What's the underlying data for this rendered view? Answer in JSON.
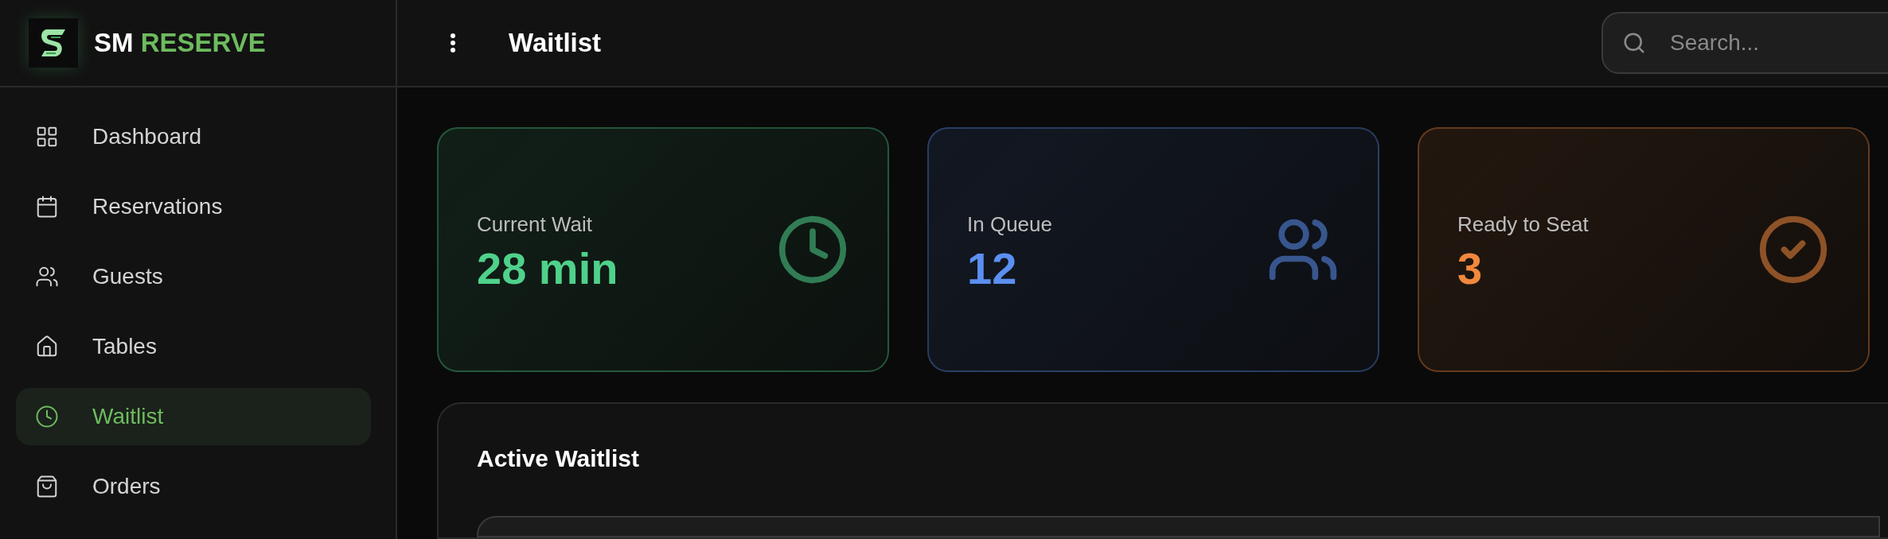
{
  "brand": {
    "name": "SM",
    "accent": "RESERVE"
  },
  "header": {
    "title": "Waitlist",
    "search": {
      "placeholder": "Search..."
    }
  },
  "sidebar": {
    "items": [
      {
        "label": "Dashboard",
        "kind": "grid",
        "selected": false
      },
      {
        "label": "Reservations",
        "kind": "calendar",
        "selected": false
      },
      {
        "label": "Guests",
        "kind": "users",
        "selected": false
      },
      {
        "label": "Tables",
        "kind": "home",
        "selected": false
      },
      {
        "label": "Waitlist",
        "kind": "clock",
        "selected": true
      },
      {
        "label": "Orders",
        "kind": "bag",
        "selected": false
      }
    ]
  },
  "stats": [
    {
      "kind": "clock",
      "label": "Current Wait",
      "value": "28 min",
      "color": "#4fd18b"
    },
    {
      "kind": "users",
      "label": "In Queue",
      "value": "12",
      "color": "#5b8ff0"
    },
    {
      "kind": "check",
      "label": "Ready to Seat",
      "value": "3",
      "color": "#f0883e"
    }
  ],
  "panel": {
    "title": "Active Waitlist"
  }
}
